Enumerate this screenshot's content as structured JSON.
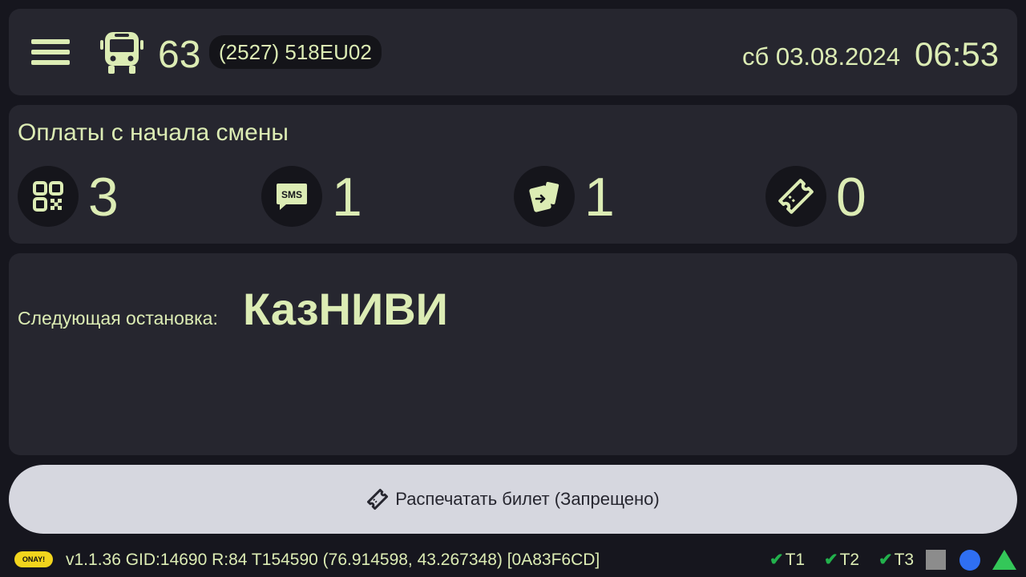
{
  "header": {
    "route_number": "63",
    "vehicle": "(2527) 518EU02",
    "date": "сб 03.08.2024",
    "time": "06:53"
  },
  "payments": {
    "title": "Оплаты с начала смены",
    "items": [
      {
        "icon": "qr-code-icon",
        "count": "3"
      },
      {
        "icon": "sms-icon",
        "count": "1"
      },
      {
        "icon": "card-tap-icon",
        "count": "1"
      },
      {
        "icon": "ticket-icon",
        "count": "0"
      }
    ]
  },
  "stop": {
    "label": "Следующая остановка:",
    "name": "КазНИВИ"
  },
  "print_button": {
    "label": "Распечатать билет (Запрещено)"
  },
  "status_bar": {
    "logo": "ONAY!",
    "info": "v1.1.36  GID:14690  R:84  T154590  (76.914598, 43.267348)  [0A83F6CD]",
    "terminals": [
      "T1",
      "T2",
      "T3"
    ],
    "colors": {
      "square": "#8c8c8c",
      "dot": "#2f6ff2",
      "triangle": "#34c759",
      "check": "#22b14c"
    }
  },
  "colors": {
    "background": "#16161e",
    "panel": "#26262f",
    "accent_text": "#dcecb4",
    "button": "#d6d7df"
  }
}
